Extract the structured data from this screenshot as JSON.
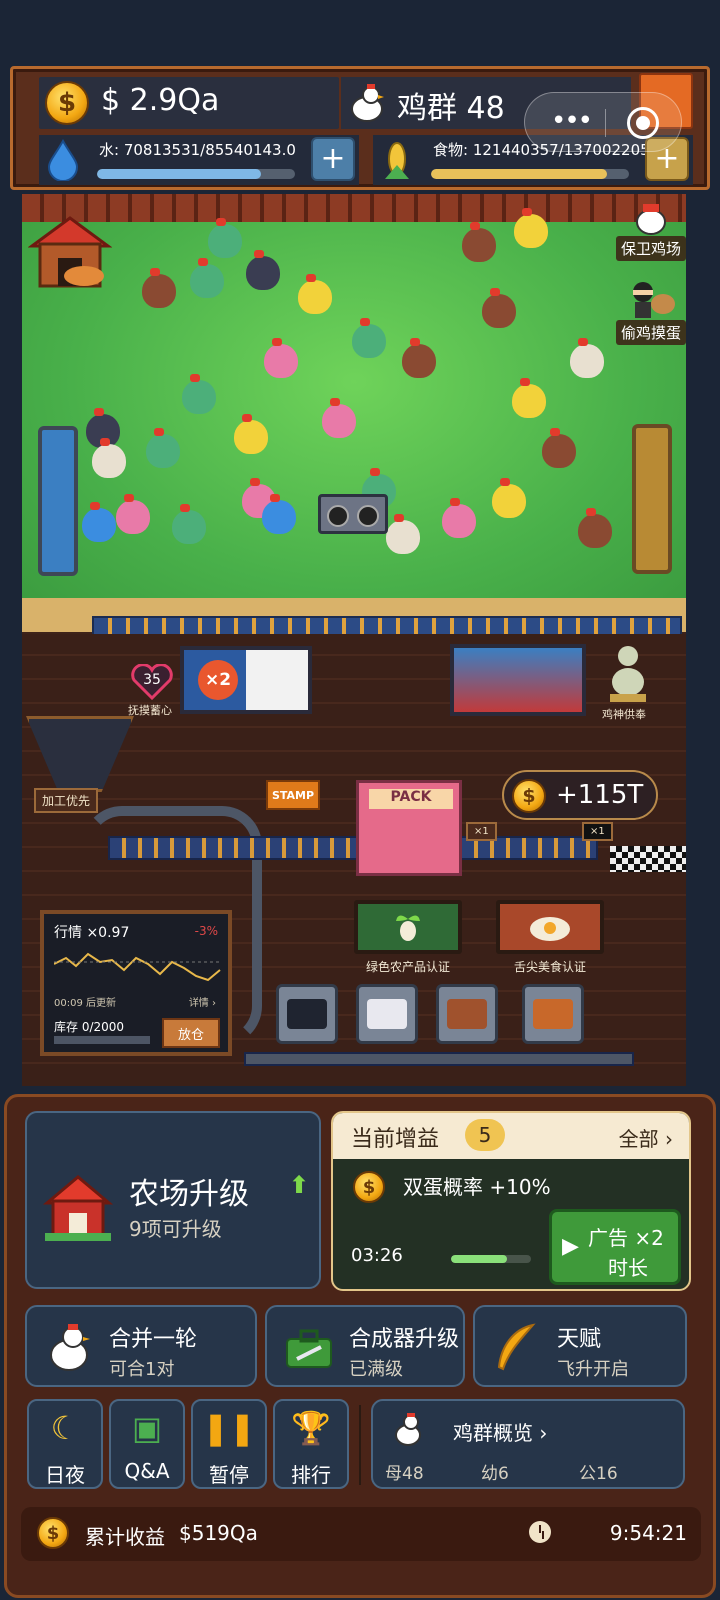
{
  "header": {
    "money": "$ 2.9Qa",
    "flock": "鸡群 48",
    "water": "水: 70813531/85540143.0",
    "water_progress": 0.83,
    "food": "食物: 121440357/137002205.0",
    "food_progress": 0.89,
    "plus": "+"
  },
  "scene": {
    "defend_farm": "保卫鸡场",
    "steal_chicken": "偷鸡摸蛋",
    "heart_value": "35",
    "heart_label": "抚摸蓄心",
    "god_label": "鸡神供奉",
    "poster_mult": "×2",
    "process_priority": "加工优先",
    "stamp": "STAMP",
    "pack": "PACK",
    "income_bubble": "+115T",
    "belt_mult_1": "×1",
    "belt_mult_2": "×1",
    "market": {
      "title": "行情 ×0.97",
      "change": "-3%",
      "update": "00:09 后更新",
      "detail": "详情 ›",
      "stock": "库存 0/2000",
      "stock_progress": 0.0,
      "sell": "放仓"
    },
    "cert_green": "绿色农产品认证",
    "cert_gourmet": "舌尖美食认证"
  },
  "panel": {
    "upgrade_title": "农场升级",
    "upgrade_sub": "9项可升级",
    "buff_title": "当前增益",
    "buff_count": "5",
    "buff_all": "全部 ›",
    "buff_text": "双蛋概率 +10%",
    "buff_timer": "03:26",
    "buff_progress": 0.7,
    "ad_line1": "广告 ×2",
    "ad_line2": "时长",
    "merge_title": "合并一轮",
    "merge_sub": "可合1对",
    "synth_title": "合成器升级",
    "synth_sub": "已满级",
    "talent_title": "天赋",
    "talent_sub": "飞升开启",
    "day_night": "日夜",
    "qa": "Q&A",
    "pause": "暂停",
    "rank": "排行",
    "overview_title": "鸡群概览 ›",
    "hens": "母48",
    "chicks": "幼6",
    "roosters": "公16",
    "total_label": "累计收益",
    "total_value": "$519Qa",
    "time": "9:54:21"
  },
  "colors": {
    "water": "#7fb8e6",
    "food": "#e8c15a",
    "accent_green": "#3f9a3a",
    "panel_brown": "#4a2418"
  }
}
